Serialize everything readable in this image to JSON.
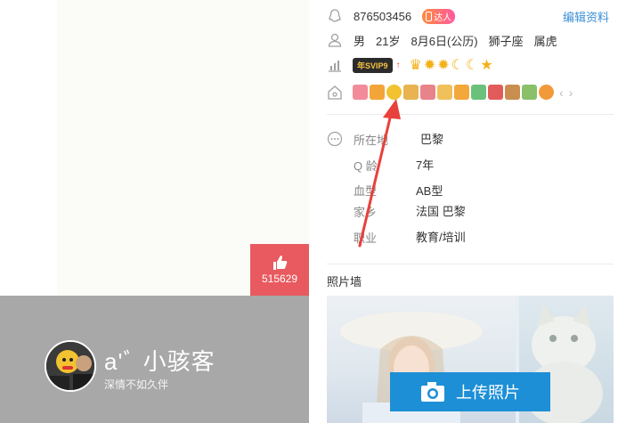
{
  "like": {
    "count": "515629"
  },
  "profile": {
    "nickname": "a'ﾞ 小骇客",
    "signature": "深情不如久伴"
  },
  "contact": {
    "qq": "876503456",
    "talent_badge": "达人",
    "edit_label": "编辑资料"
  },
  "basic": {
    "gender": "男",
    "age": "21岁",
    "birthday": "8月6日(公历)",
    "zodiac": "狮子座",
    "chinese_zodiac": "属虎"
  },
  "level": {
    "vip_badge": "年SVIP9"
  },
  "details": [
    {
      "label": "所在地",
      "value": "巴黎"
    },
    {
      "label": "Q 龄",
      "value": "7年"
    },
    {
      "label": "血型",
      "value": "AB型"
    },
    {
      "label": "家乡",
      "value": "法国 巴黎"
    },
    {
      "label": "职业",
      "value": "教育/培训"
    }
  ],
  "photo_wall": {
    "title": "照片墙",
    "upload_label": "上传照片"
  },
  "colors": {
    "like_red": "#e85a5f",
    "upload_blue": "#1d8fd6",
    "edit_blue": "#3a8fd6",
    "arrow_red": "#e8413b"
  }
}
